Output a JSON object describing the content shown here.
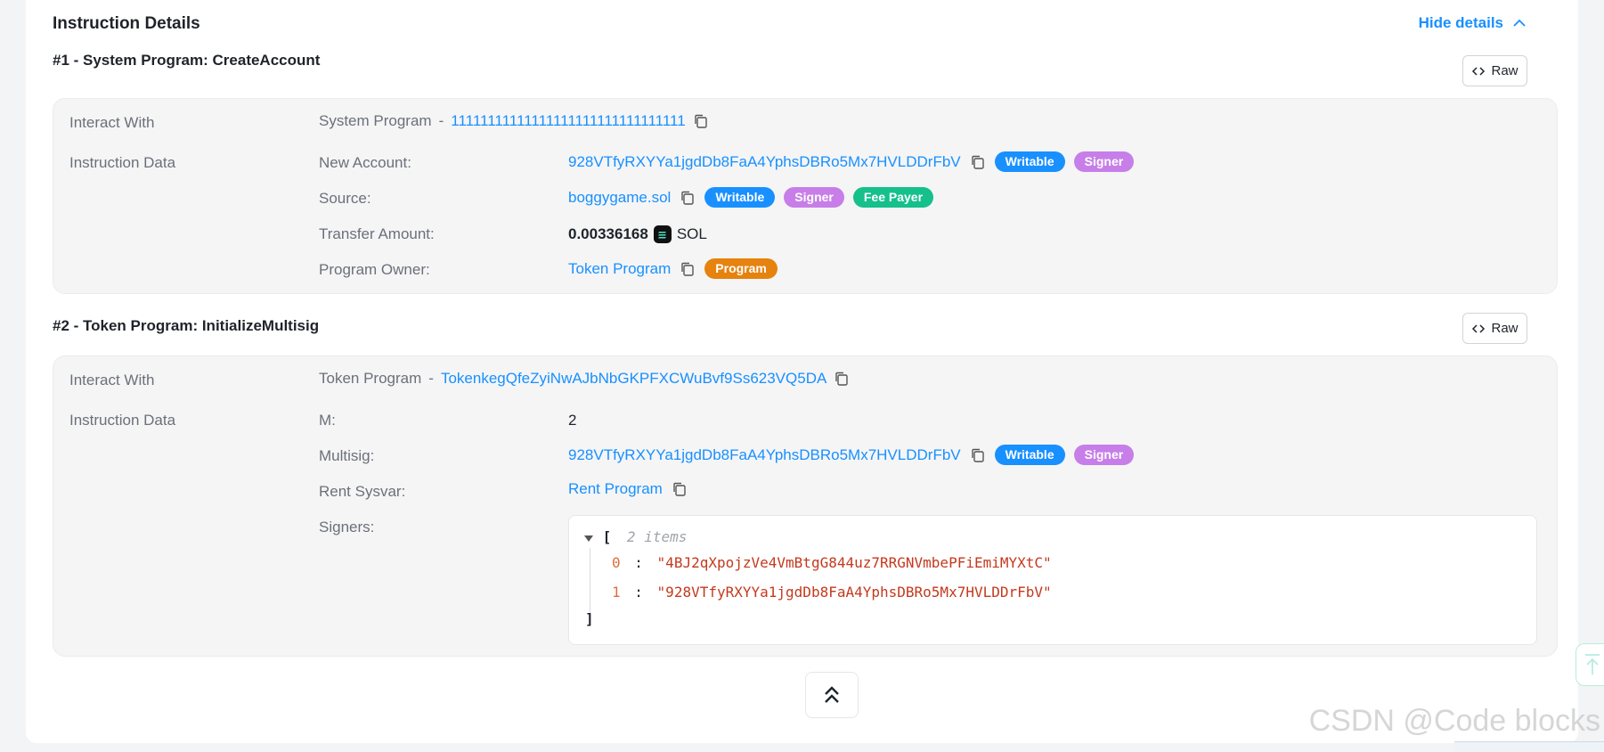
{
  "header": {
    "title": "Instruction Details",
    "hide_details": "Hide details"
  },
  "raw_label": "Raw",
  "instructions": [
    {
      "title": "#1 - System Program: CreateAccount",
      "interact_label": "Interact With",
      "program_name": "System Program",
      "program_sep": "-",
      "program_address": "11111111111111111111111111111111",
      "data_label": "Instruction Data",
      "fields": {
        "new_account_label": "New Account:",
        "new_account_value": "928VTfyRXYYa1jgdDb8FaA4YphsDBRo5Mx7HVLDDrFbV",
        "source_label": "Source:",
        "source_value": "boggygame.sol",
        "transfer_label": "Transfer Amount:",
        "transfer_amount": "0.00336168",
        "transfer_unit": "SOL",
        "owner_label": "Program Owner:",
        "owner_value": "Token Program"
      }
    },
    {
      "title": "#2 - Token Program: InitializeMultisig",
      "interact_label": "Interact With",
      "program_name": "Token Program",
      "program_sep": "-",
      "program_address": "TokenkegQfeZyiNwAJbNbGKPFXCWuBvf9Ss623VQ5DA",
      "data_label": "Instruction Data",
      "fields": {
        "m_label": "M:",
        "m_value": "2",
        "multisig_label": "Multisig:",
        "multisig_value": "928VTfyRXYYa1jgdDb8FaA4YphsDBRo5Mx7HVLDDrFbV",
        "rent_label": "Rent Sysvar:",
        "rent_value": "Rent Program",
        "signers_label": "Signers:"
      },
      "signers_json": {
        "open": "[",
        "meta": "2 items",
        "items": [
          {
            "index": "0",
            "value": "\"4BJ2qXpojzVe4VmBtgG844uz7RRGNVmbePFiEmiMYXtC\""
          },
          {
            "index": "1",
            "value": "\"928VTfyRXYYa1jgdDb8FaA4YphsDBRo5Mx7HVLDDrFbV\""
          }
        ],
        "close": "]"
      }
    }
  ],
  "badges": {
    "writable": "Writable",
    "signer": "Signer",
    "fee_payer": "Fee Payer",
    "program": "Program"
  },
  "watermark": "CSDN @Code blocks",
  "colors": {
    "link": "#1890ff",
    "writable": "#1890ff",
    "signer": "#c77ee8",
    "fee_payer": "#15c08b",
    "program": "#e6820e"
  }
}
